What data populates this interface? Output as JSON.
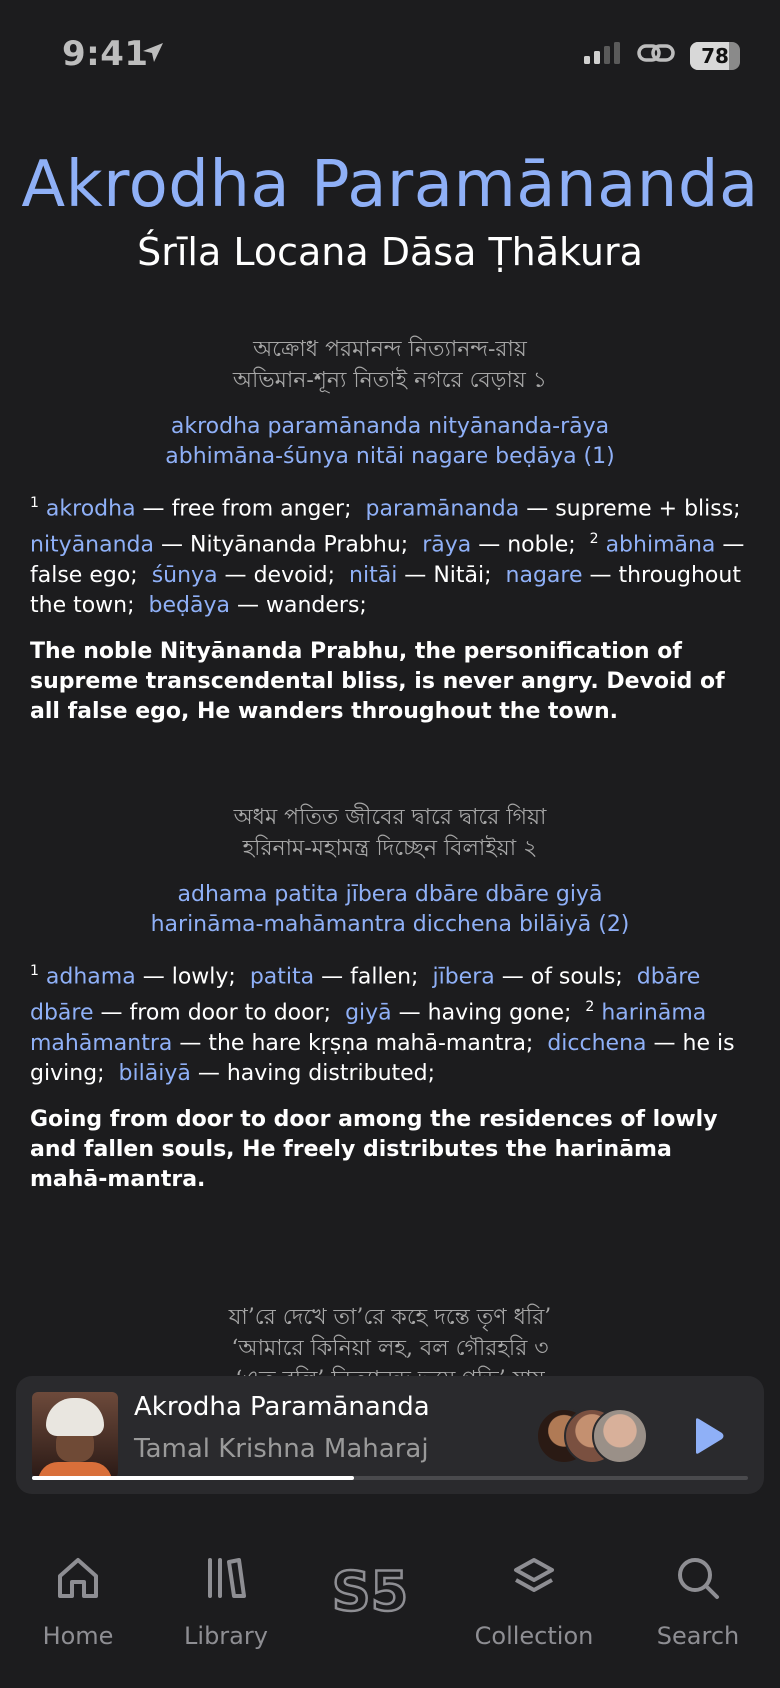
{
  "status": {
    "time": "9:41",
    "battery": 78,
    "battery_label": "78"
  },
  "header": {
    "title": "Akrodha Paramānanda",
    "author": "Śrīla Locana Dāsa Ṭhākura"
  },
  "verses": [
    {
      "bengali": [
        "অক্রোধ পরমানন্দ নিত্যানন্দ-রায়",
        "অভিমান-শূন্য নিতাই নগরে বেড়ায়     ১"
      ],
      "translit": [
        "akrodha paramānanda nityānanda-rāya",
        "abhimāna-śūnya nitāi nagare beḍāya (1)"
      ],
      "synonyms": {
        "w1": "akrodha",
        "m1": "free from anger;",
        "w2": "paramānanda",
        "m2": "supreme + bliss;",
        "w3": "nityānanda",
        "m3": "Nityānanda Prabhu;",
        "w4": "rāya",
        "m4": "noble;",
        "w5": "abhimāna",
        "m5": "false ego;",
        "w6": "śūnya",
        "m6": "devoid;",
        "w7": "nitāi",
        "m7": "Nitāi;",
        "w8": "nagare",
        "m8": "throughout the town;",
        "w9": "beḍāya",
        "m9": "wanders;"
      },
      "translation": "The noble Nityānanda Prabhu, the personification of supreme transcendental bliss, is never angry. Devoid of all false ego, He wanders throughout the town."
    },
    {
      "bengali": [
        "অধম পতিত জীবের দ্বারে দ্বারে গিয়া",
        "হরিনাম-মহামন্ত্র দিচ্ছেন বিলাইয়া     ২"
      ],
      "translit": [
        "adhama patita jībera dbāre dbāre giyā",
        "harināma-mahāmantra dicchena bilāiyā (2)"
      ],
      "synonyms": {
        "w1": "adhama",
        "m1": "lowly;",
        "w2": "patita",
        "m2": "fallen;",
        "w3": "jībera",
        "m3": "of souls;",
        "w4": "dbāre dbāre",
        "m4": "from door to door;",
        "w5": "giyā",
        "m5": "having gone;",
        "w6": "harināma mahāmantra",
        "m6": "the hare kṛṣṇa mahā-mantra;",
        "w7": "dicchena",
        "m7": "he is giving;",
        "w8": "bilāiyā",
        "m8": "having distributed;"
      },
      "translation": "Going from door to door among the residences of lowly and fallen souls, He freely distributes the harināma mahā-mantra."
    },
    {
      "bengali": [
        "যা’রে দেখে তা’রে কহে দন্তে তৃণ ধরি’",
        "‘আমারে কিনিয়া লহ, বল গৌরহরি     ৩",
        "‘এত বলি’ নিত্যানন্দ ভূমে গড়ি’ যায়"
      ]
    }
  ],
  "player": {
    "title": "Akrodha Paramānanda",
    "artist": "Tamal Krishna Maharaj",
    "progress": 0.45
  },
  "tabs": [
    {
      "label": "Home",
      "icon": "home-icon"
    },
    {
      "label": "Library",
      "icon": "library-icon"
    },
    {
      "label": "",
      "icon": "s5-logo-icon"
    },
    {
      "label": "Collection",
      "icon": "collection-icon"
    },
    {
      "label": "Search",
      "icon": "search-icon"
    }
  ],
  "colors": {
    "accent": "#8fb0f7",
    "background": "#1c1c1e",
    "player_bg": "#2a2a2d"
  }
}
